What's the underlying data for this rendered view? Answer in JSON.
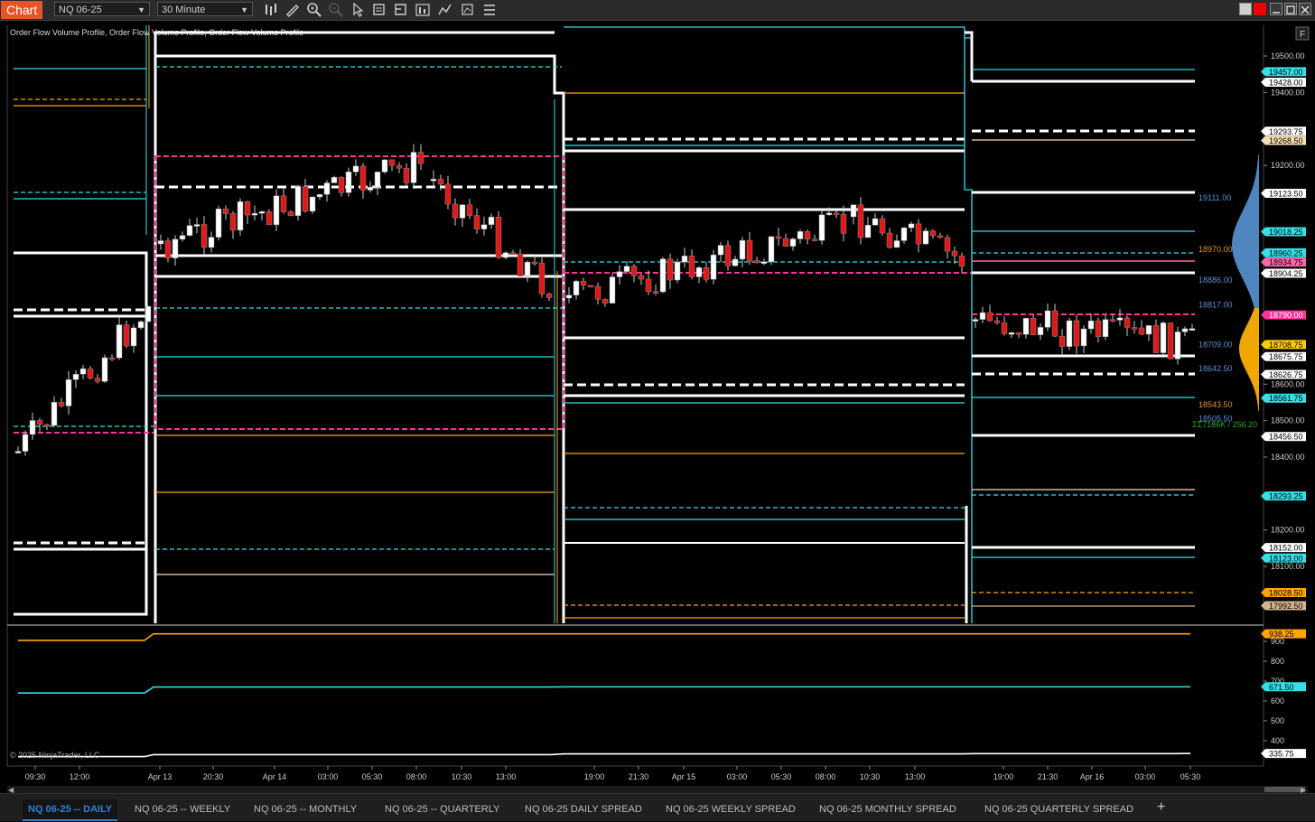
{
  "app": {
    "title": "Chart",
    "instrument": "NQ 06-25",
    "interval": "30 Minute"
  },
  "indicator_label": "Order Flow Volume Profile, Order Flow Volume Profile, Order Flow Volume Profile",
  "copyright": "© 2025 NinjaTrader, LLC",
  "f_button": "F",
  "chart_data": {
    "type": "candlestick",
    "price_axis": {
      "ticks": [
        "19500.00",
        "19400.00",
        "19200.00",
        "18600.00",
        "18500.00",
        "18400.00",
        "18200.00",
        "18100.00"
      ],
      "ylim": [
        18000,
        19600
      ]
    },
    "price_markers": [
      {
        "value": "19457.00",
        "color": "#33e0e8",
        "text": "#000"
      },
      {
        "value": "19428.00",
        "color": "#ffffff",
        "text": "#000"
      },
      {
        "value": "19293.75",
        "color": "#ffffff",
        "text": "#000"
      },
      {
        "value": "19268.50",
        "color": "#f5deb3",
        "text": "#000"
      },
      {
        "value": "19123.50",
        "color": "#ffffff",
        "text": "#000"
      },
      {
        "value": "19018.25",
        "color": "#33e0e8",
        "text": "#000"
      },
      {
        "value": "18960.25",
        "color": "#33e0e8",
        "text": "#000"
      },
      {
        "value": "18934.75",
        "color": "#ff66aa",
        "text": "#000"
      },
      {
        "value": "18904.25",
        "color": "#ffffff",
        "text": "#000"
      },
      {
        "value": "18790.00",
        "color": "#ff3399",
        "text": "#fff"
      },
      {
        "value": "18708.75",
        "color": "#ffcc00",
        "text": "#000"
      },
      {
        "value": "18675.75",
        "color": "#ffffff",
        "text": "#000"
      },
      {
        "value": "18626.75",
        "color": "#ffffff",
        "text": "#000"
      },
      {
        "value": "18561.75",
        "color": "#33e0e8",
        "text": "#000"
      },
      {
        "value": "18456.50",
        "color": "#ffffff",
        "text": "#000"
      },
      {
        "value": "18293.25",
        "color": "#33e0e8",
        "text": "#000"
      },
      {
        "value": "18152.00",
        "color": "#ffffff",
        "text": "#000"
      },
      {
        "value": "18123.00",
        "color": "#33e0e8",
        "text": "#000"
      },
      {
        "value": "18028.50",
        "color": "#ffa500",
        "text": "#000"
      },
      {
        "value": "17992.50",
        "color": "#d2b48c",
        "text": "#000"
      }
    ],
    "profile_labels": [
      {
        "value": "19111.00",
        "color": "#5a8fd6"
      },
      {
        "value": "18970.00",
        "color": "#e0902a"
      },
      {
        "value": "18886.00",
        "color": "#5a8fd6"
      },
      {
        "value": "18817.00",
        "color": "#5a8fd6"
      },
      {
        "value": "18709.00",
        "color": "#5a8fd6"
      },
      {
        "value": "18642.50",
        "color": "#5a8fd6"
      },
      {
        "value": "18543.50",
        "color": "#e0902a"
      },
      {
        "value": "18505.50",
        "color": "#5a8fd6"
      }
    ],
    "volume_summary": "ΣΣ7186K / 256.20",
    "lower_panel": {
      "ticks": [
        "900",
        "800",
        "700",
        "600",
        "500",
        "400"
      ],
      "markers": [
        {
          "value": "938.25",
          "color": "#ffa500"
        },
        {
          "value": "671.50",
          "color": "#33e0e8"
        },
        {
          "value": "335.75",
          "color": "#ffffff"
        }
      ],
      "series": [
        {
          "color": "#ffa500",
          "values": [
            905,
            905,
            938,
            938,
            938,
            938,
            938,
            938,
            938
          ]
        },
        {
          "color": "#33e0e8",
          "values": [
            640,
            640,
            670,
            670,
            671,
            671,
            671,
            671,
            671
          ]
        },
        {
          "color": "#ffffff",
          "values": [
            320,
            320,
            330,
            330,
            334,
            334,
            335,
            335,
            336
          ]
        }
      ]
    },
    "time_axis": [
      "09:30",
      "12:00",
      "Apr 13",
      "20:30",
      "Apr 14",
      "03:00",
      "05:30",
      "08:00",
      "10:30",
      "13:00",
      "19:00",
      "21:30",
      "Apr 15",
      "03:00",
      "05:30",
      "08:00",
      "10:30",
      "13:00",
      "19:00",
      "21:30",
      "Apr 16",
      "03:00",
      "05:30"
    ]
  },
  "tabs": [
    {
      "label": "NQ 06-25 -- DAILY",
      "active": true
    },
    {
      "label": "NQ 06-25 -- WEEKLY",
      "active": false
    },
    {
      "label": "NQ 06-25 -- MONTHLY",
      "active": false
    },
    {
      "label": "NQ 06-25 -- QUARTERLY",
      "active": false
    },
    {
      "label": "NQ 06-25 DAILY SPREAD",
      "active": false
    },
    {
      "label": "NQ 06-25 WEEKLY SPREAD",
      "active": false
    },
    {
      "label": "NQ 06-25 MONTHLY SPREAD",
      "active": false
    },
    {
      "label": "NQ 06-25 QUARTERLY SPREAD",
      "active": false
    }
  ],
  "add_tab": "+"
}
